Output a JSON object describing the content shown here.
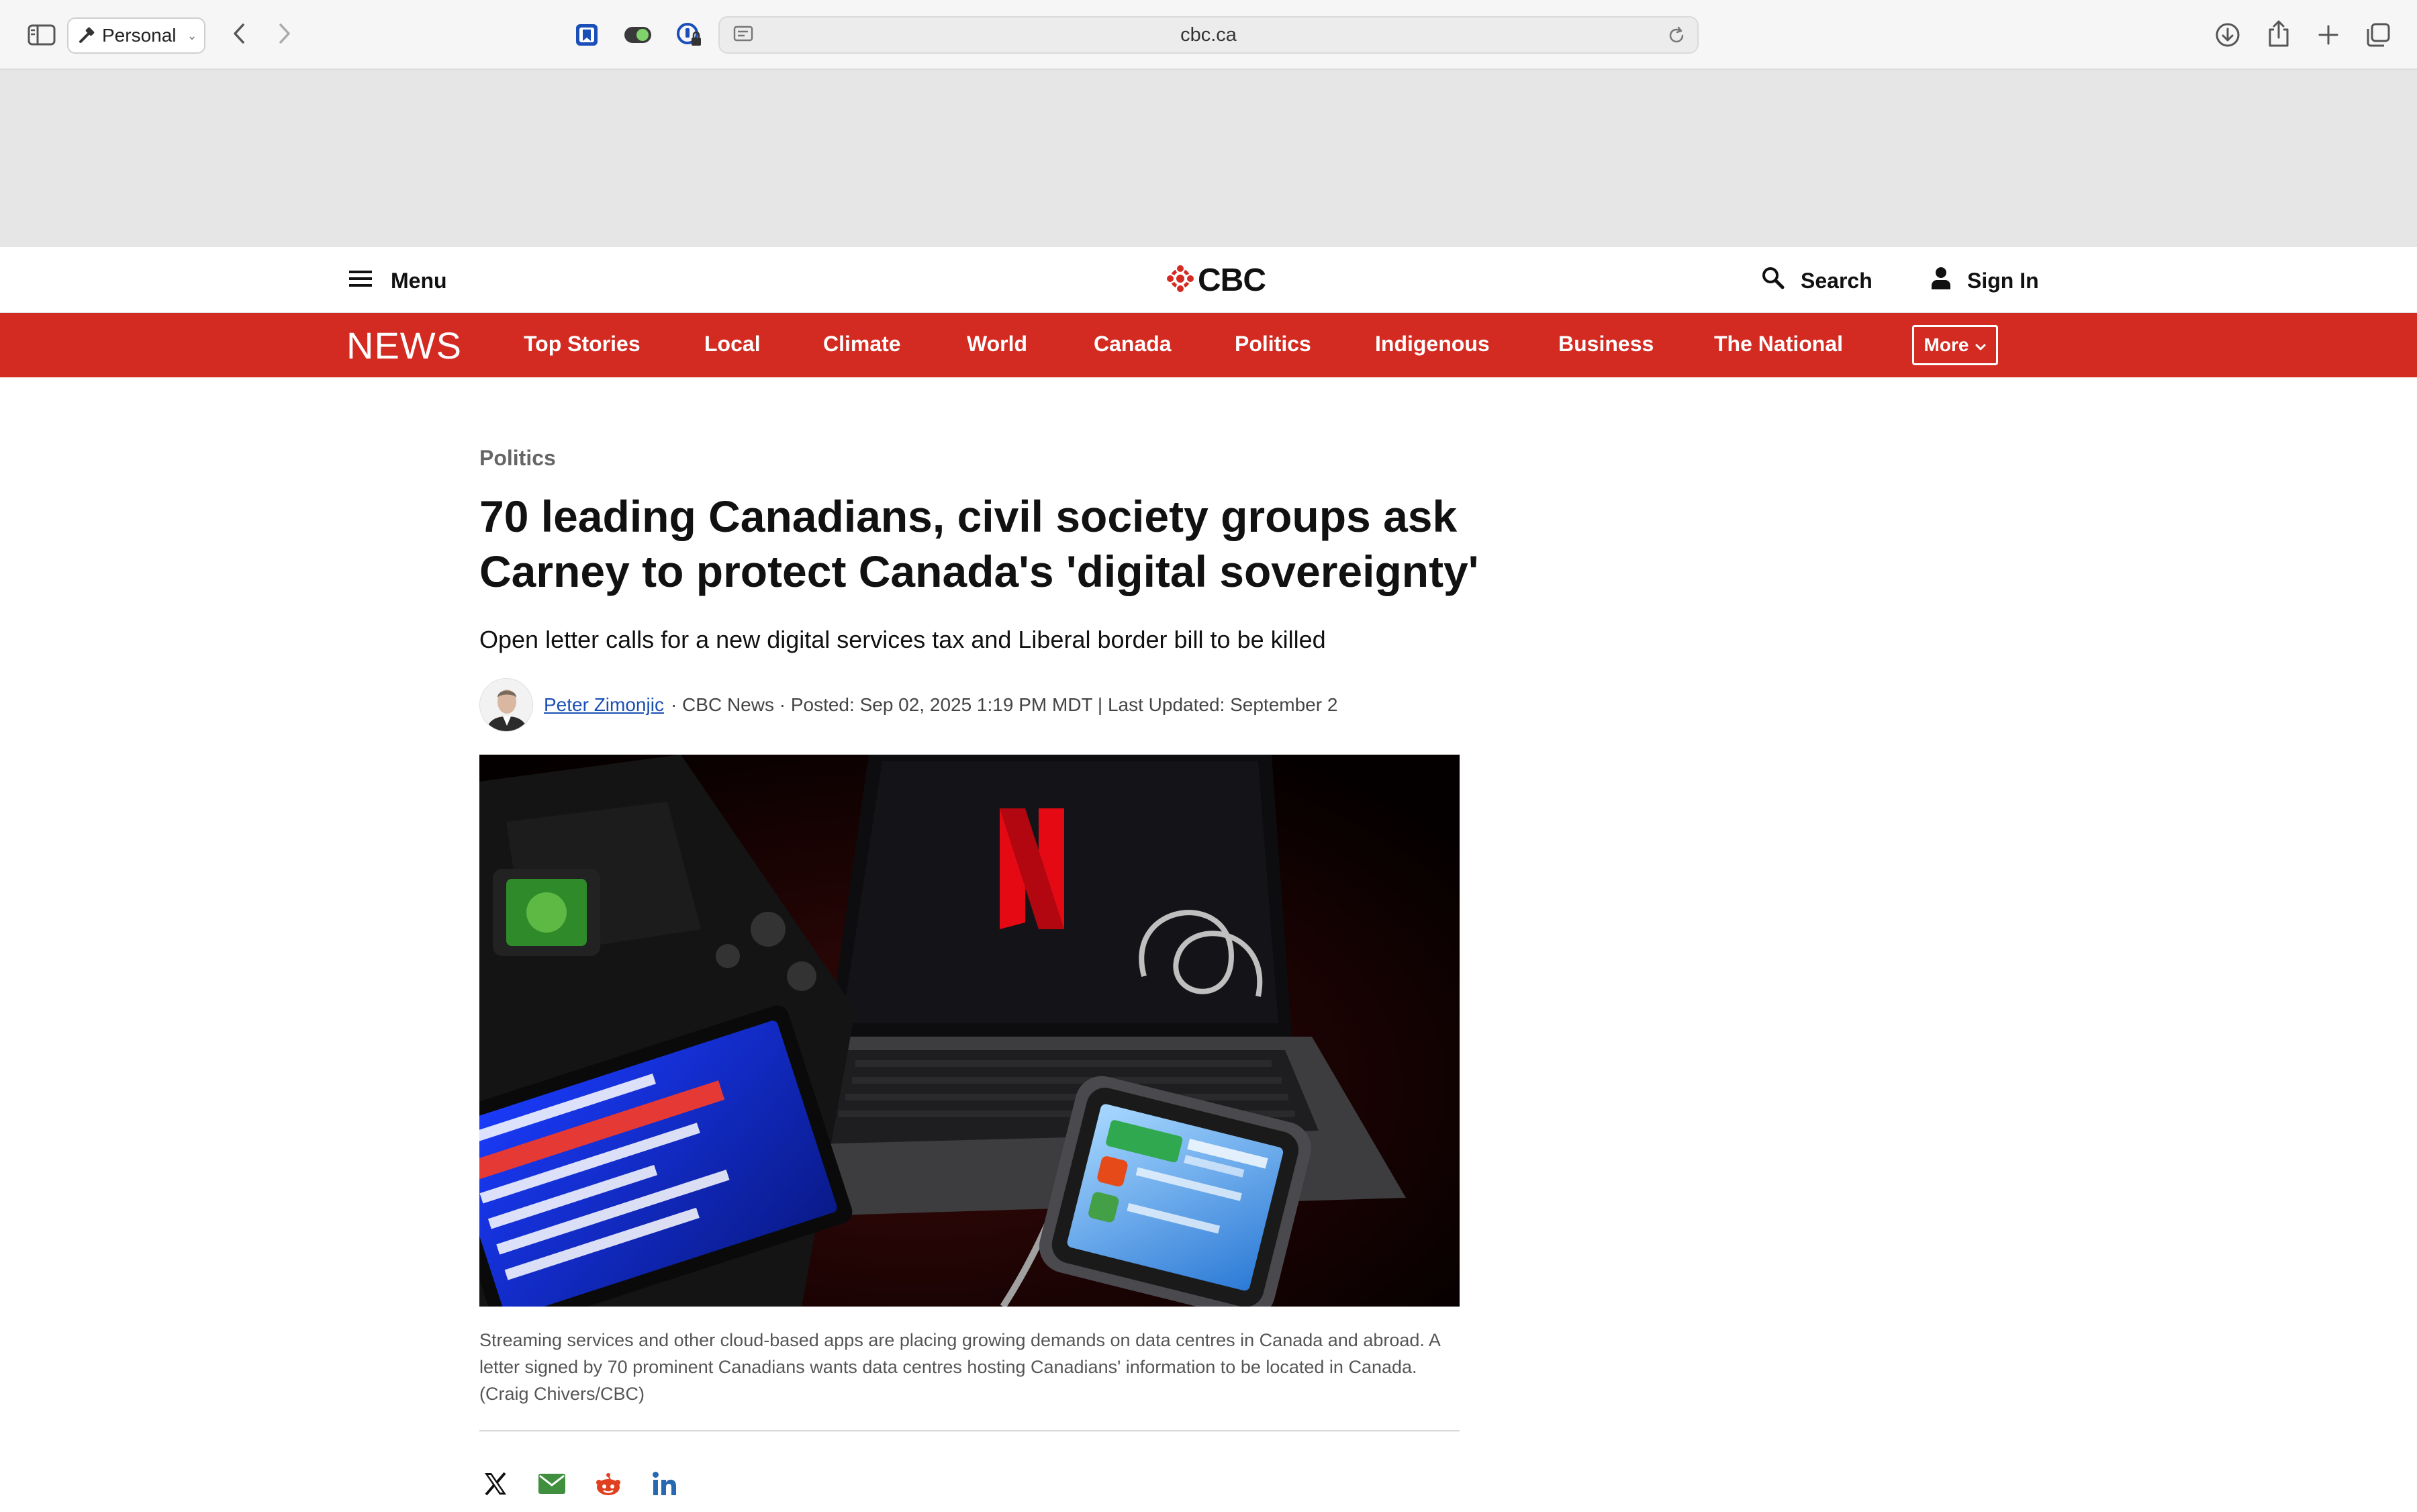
{
  "browser": {
    "profile_label": "Personal",
    "url": "cbc.ca"
  },
  "header": {
    "menu_label": "Menu",
    "logo_text": "CBC",
    "search_label": "Search",
    "signin_label": "Sign In"
  },
  "nav": {
    "brand": "NEWS",
    "items": [
      {
        "label": "Top Stories"
      },
      {
        "label": "Local"
      },
      {
        "label": "Climate"
      },
      {
        "label": "World"
      },
      {
        "label": "Canada"
      },
      {
        "label": "Politics"
      },
      {
        "label": "Indigenous"
      },
      {
        "label": "Business"
      },
      {
        "label": "The National"
      }
    ],
    "more_label": "More"
  },
  "article": {
    "category": "Politics",
    "headline_line1": "70 leading Canadians, civil society groups ask",
    "headline_line2": "Carney to protect Canada's 'digital sovereignty'",
    "dek": "Open letter calls for a new digital services tax and Liberal border bill to be killed",
    "author": "Peter Zimonjic",
    "byline_meta": "· CBC News · Posted: Sep 02, 2025 1:19 PM MDT | Last Updated: September 2",
    "photo_screen_logo": "N",
    "caption": "Streaming services and other cloud-based apps are placing growing demands on data centres in Canada and abroad. A letter signed by 70 prominent Canadians wants data centres hosting Canadians' information to be located in Canada. (Craig Chivers/CBC)"
  },
  "share": {
    "icons": [
      "x-icon",
      "email-icon",
      "reddit-icon",
      "linkedin-icon"
    ]
  },
  "colors": {
    "cbc_red": "#d32a21",
    "link_blue": "#1a4fb5",
    "ad_band": "#e6e6e6"
  }
}
